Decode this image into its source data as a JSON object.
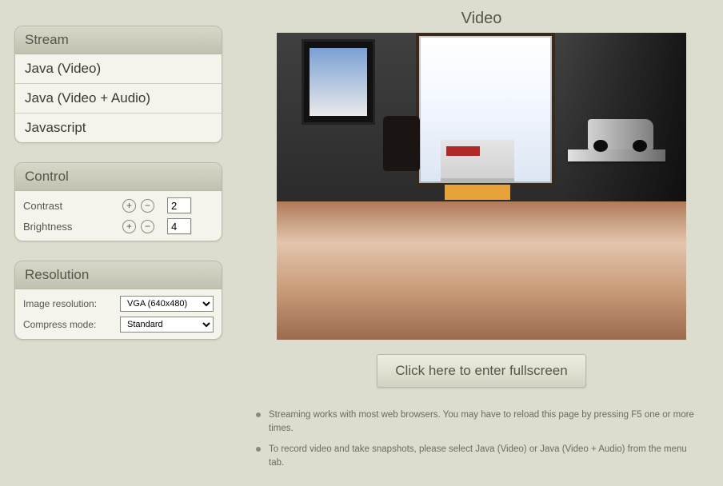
{
  "stream": {
    "header": "Stream",
    "items": [
      "Java (Video)",
      "Java (Video + Audio)",
      "Javascript"
    ]
  },
  "control": {
    "header": "Control",
    "rows": [
      {
        "label": "Contrast",
        "value": "2"
      },
      {
        "label": "Brightness",
        "value": "4"
      }
    ],
    "plus_glyph": "+",
    "minus_glyph": "−"
  },
  "resolution": {
    "header": "Resolution",
    "img_label": "Image resolution:",
    "img_value": "VGA (640x480)",
    "compress_label": "Compress mode:",
    "compress_value": "Standard"
  },
  "video": {
    "title": "Video",
    "fullscreen_label": "Click here to enter fullscreen"
  },
  "notes": [
    "Streaming works with most web browsers. You may have to reload this page by pressing F5 one or more times.",
    "To record video and take snapshots, please select Java (Video) or Java (Video + Audio) from the menu tab."
  ]
}
